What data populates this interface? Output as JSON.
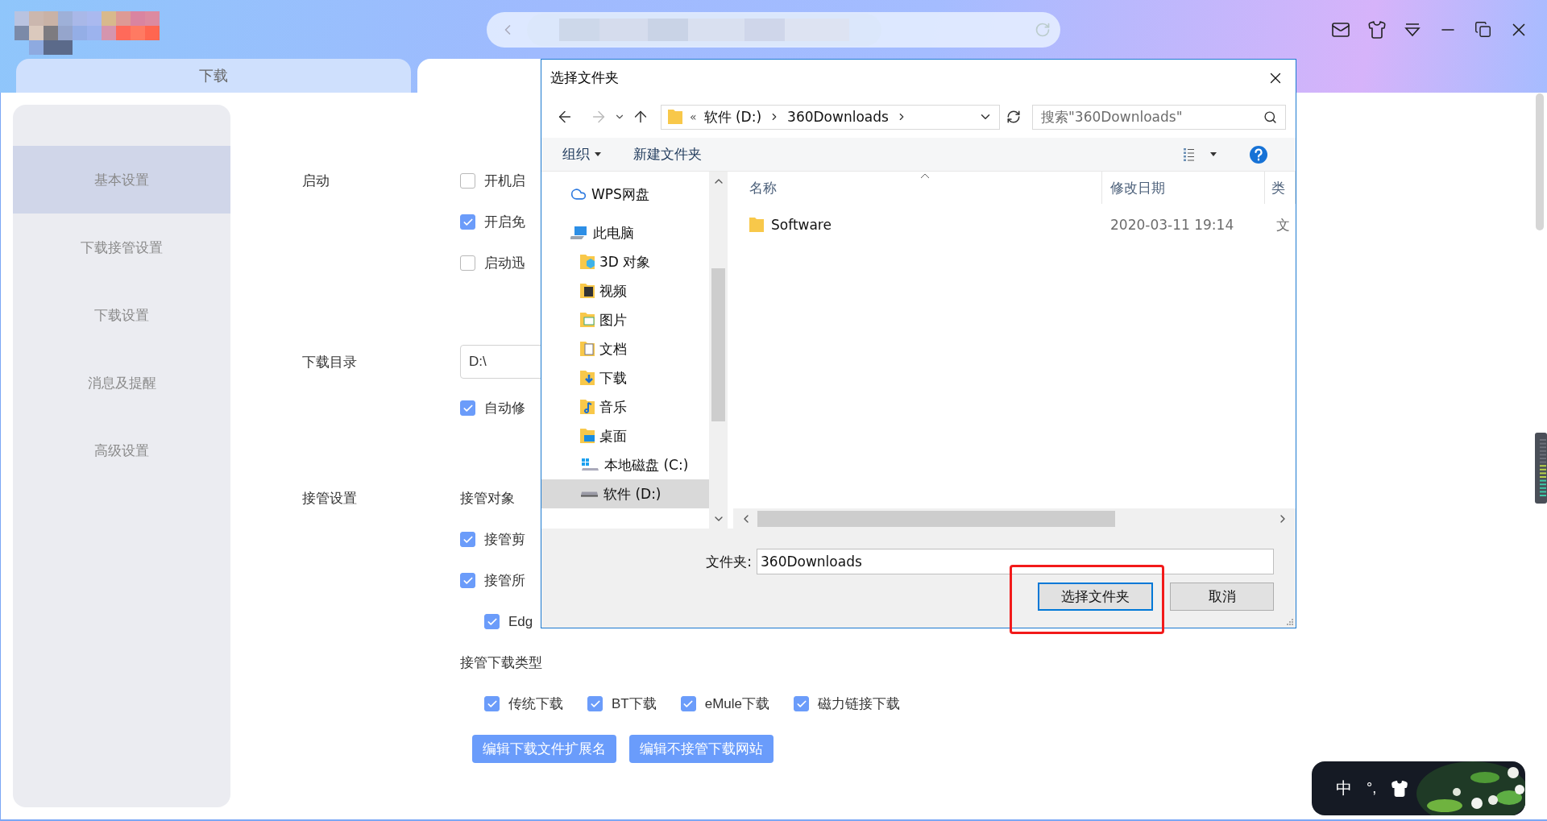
{
  "tabs": [
    {
      "label": "下载",
      "selected": false
    }
  ],
  "sidebar": {
    "items": [
      {
        "label": "基本设置",
        "selected": true
      },
      {
        "label": "下载接管设置",
        "selected": false
      },
      {
        "label": "下载设置",
        "selected": false
      },
      {
        "label": "消息及提醒",
        "selected": false
      },
      {
        "label": "高级设置",
        "selected": false
      }
    ]
  },
  "sections": [
    {
      "label": "启动",
      "rows": [
        {
          "kind": "checkbox",
          "label": "开机启",
          "checked": false
        },
        {
          "kind": "checkbox",
          "label": "开启免",
          "checked": true
        },
        {
          "kind": "checkbox",
          "label": "启动迅",
          "checked": false
        }
      ]
    },
    {
      "label": "下载目录",
      "rows": [
        {
          "kind": "field",
          "value": "D:\\"
        },
        {
          "kind": "checkbox",
          "label": "自动修",
          "checked": true
        }
      ]
    },
    {
      "label": "接管设置",
      "rows": [
        {
          "kind": "heading",
          "label": "接管对象"
        },
        {
          "kind": "checkbox",
          "label": "接管剪",
          "checked": true
        },
        {
          "kind": "checkbox",
          "label": "接管所",
          "checked": true
        },
        {
          "kind": "subcheckbox",
          "label": "Edg",
          "checked": true
        },
        {
          "kind": "heading",
          "label": "接管下载类型"
        },
        {
          "kind": "checkgroup",
          "items": [
            {
              "label": "传统下载",
              "checked": true
            },
            {
              "label": "BT下载",
              "checked": true
            },
            {
              "label": "eMule下载",
              "checked": true
            },
            {
              "label": "磁力链接下载",
              "checked": true
            }
          ]
        },
        {
          "kind": "buttons",
          "items": [
            "编辑下载文件扩展名",
            "编辑不接管下载网站"
          ]
        }
      ]
    }
  ],
  "dialog": {
    "title": "选择文件夹",
    "address": {
      "overflow": "«",
      "path": [
        "软件 (D:)",
        "360Downloads"
      ]
    },
    "search": {
      "placeholder": "搜索\"360Downloads\""
    },
    "toolbar": [
      {
        "label": "组织",
        "menu": true
      },
      {
        "label": "新建文件夹",
        "menu": false
      }
    ],
    "nav_tree": [
      {
        "kind": "cloud",
        "label": "WPS网盘",
        "selected": false
      },
      {
        "kind": "computer",
        "label": "此电脑",
        "selected": false,
        "children": [
          {
            "kind": "folder_3d",
            "label": "3D 对象",
            "selected": false
          },
          {
            "kind": "folder_video",
            "label": "视频",
            "selected": false
          },
          {
            "kind": "folder_pictures",
            "label": "图片",
            "selected": false
          },
          {
            "kind": "folder_docs",
            "label": "文档",
            "selected": false
          },
          {
            "kind": "folder_downloads",
            "label": "下载",
            "selected": false
          },
          {
            "kind": "folder_music",
            "label": "音乐",
            "selected": false
          },
          {
            "kind": "folder_desktop",
            "label": "桌面",
            "selected": false
          },
          {
            "kind": "system_drive",
            "label": "本地磁盘 (C:)",
            "selected": false
          },
          {
            "kind": "drive",
            "label": "软件 (D:)",
            "selected": true
          }
        ]
      }
    ],
    "columns": [
      "名称",
      "修改日期",
      "类"
    ],
    "rows": [
      {
        "cells": [
          "Software",
          "2020-03-11 19:14",
          "文"
        ]
      }
    ],
    "folder_label": "文件夹:",
    "folder_value": "360Downloads",
    "buttons": [
      {
        "label": "选择文件夹",
        "default": true
      },
      {
        "label": "取消",
        "default": false
      }
    ]
  },
  "ime": {
    "mode": "中",
    "punctuation": "°,"
  }
}
